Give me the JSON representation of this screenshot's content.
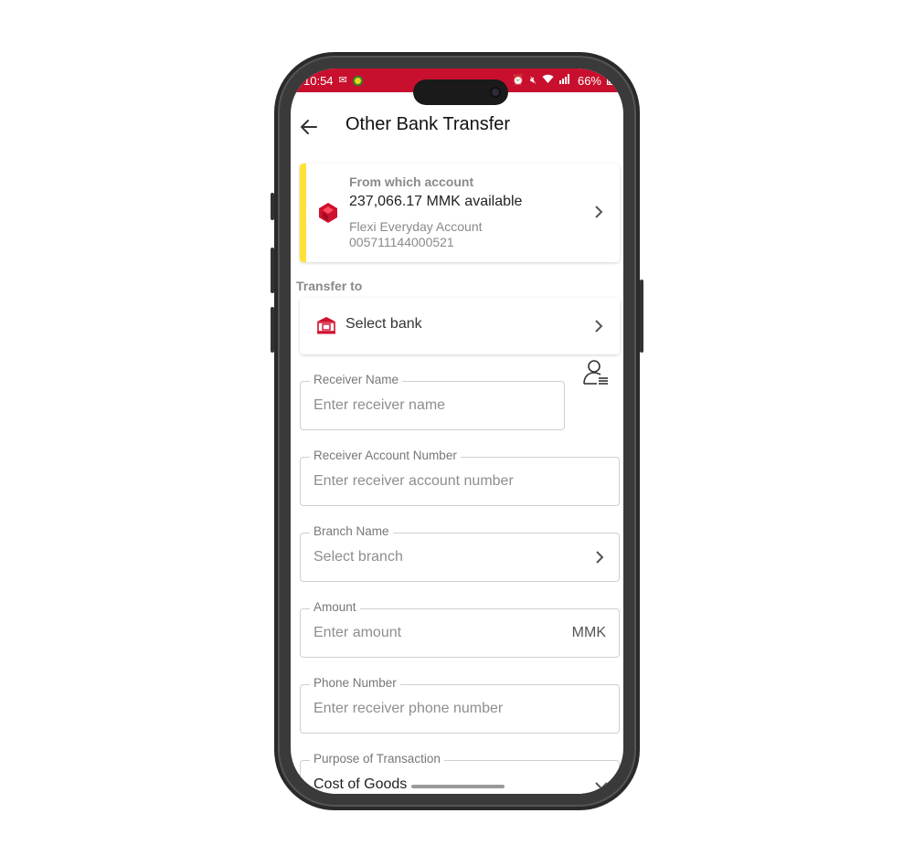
{
  "status_bar": {
    "time": "10:54",
    "battery": "66%",
    "bg_color": "#c8102e"
  },
  "header": {
    "title": "Other Bank Transfer"
  },
  "from_account": {
    "label": "From which account",
    "balance": "237,066.17 MMK available",
    "account_name": "Flexi Everyday Account",
    "account_number": "005711144000521",
    "accent_color": "#ffe13a"
  },
  "transfer_to": {
    "label": "Transfer to",
    "select_bank": "Select bank"
  },
  "form": {
    "receiver_name": {
      "label": "Receiver Name",
      "placeholder": "Enter receiver name"
    },
    "receiver_account": {
      "label": "Receiver Account Number",
      "placeholder": "Enter receiver account number"
    },
    "branch": {
      "label": "Branch Name",
      "placeholder": "Select branch"
    },
    "amount": {
      "label": "Amount",
      "placeholder": "Enter amount",
      "currency": "MMK"
    },
    "phone": {
      "label": "Phone Number",
      "placeholder": "Enter receiver phone number"
    },
    "purpose": {
      "label": "Purpose of Transaction",
      "value": "Cost of Goods"
    }
  },
  "icons": {
    "back": "arrow-left-icon",
    "bank_logo": "bank-logo-icon",
    "building": "bank-building-icon",
    "contact": "contact-book-icon",
    "chevron_right": "chevron-right-icon",
    "chevron_down": "chevron-down-icon"
  }
}
